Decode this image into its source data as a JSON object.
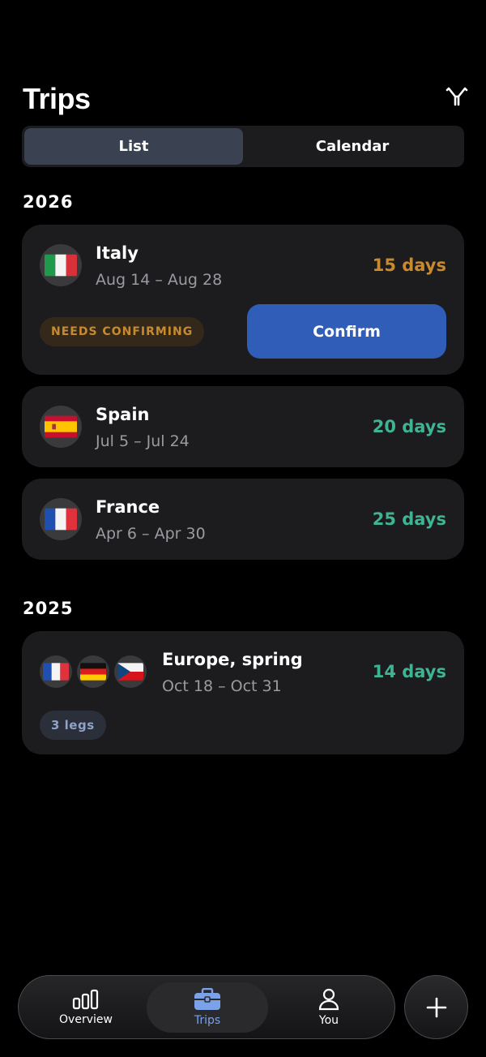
{
  "header": {
    "title": "Trips"
  },
  "segmented": {
    "list_label": "List",
    "calendar_label": "Calendar",
    "selected": "List"
  },
  "sections": [
    {
      "year": "2026",
      "trips": [
        {
          "name": "Italy",
          "dates": "Aug 14 – Aug 28",
          "days": "15 days",
          "status": "NEEDS CONFIRMING",
          "action": "Confirm",
          "flags": [
            "italy-flag-icon"
          ]
        },
        {
          "name": "Spain",
          "dates": "Jul 5 – Jul 24",
          "days": "20 days",
          "flags": [
            "spain-flag-icon"
          ]
        },
        {
          "name": "France",
          "dates": "Apr 6 – Apr 30",
          "days": "25 days",
          "flags": [
            "france-flag-icon"
          ]
        }
      ]
    },
    {
      "year": "2025",
      "trips": [
        {
          "name": "Europe, spring",
          "dates": "Oct 18 – Oct 31",
          "days": "14 days",
          "legs": "3 legs",
          "flags": [
            "france-flag-icon",
            "germany-flag-icon",
            "czech-flag-icon"
          ]
        }
      ]
    }
  ],
  "tabbar": {
    "tabs": [
      {
        "label": "Overview",
        "icon": "bar-chart-icon"
      },
      {
        "label": "Trips",
        "icon": "briefcase-icon"
      },
      {
        "label": "You",
        "icon": "person-icon"
      }
    ],
    "selected": "Trips"
  },
  "colors": {
    "accent_blue": "#2f5db8",
    "days_pending": "#c78a2e",
    "days_confirmed": "#3fb392",
    "active_tab": "#7ba2e8"
  }
}
